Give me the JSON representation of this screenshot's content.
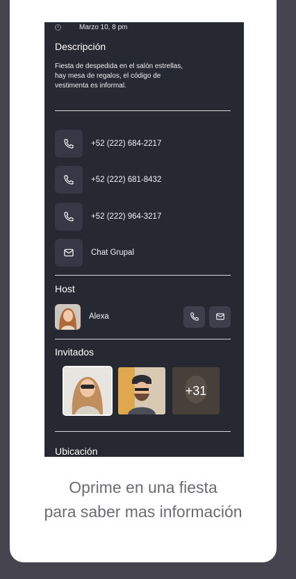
{
  "event": {
    "date": "Marzo 10, 8 pm",
    "description_title": "Descripción",
    "description": "Fiesta de despedida en el salón estrellas, hay mesa de regalos, el código de vestimenta es informal."
  },
  "contacts": [
    {
      "label": "+52 (222) 684-2217",
      "icon": "phone-icon"
    },
    {
      "label": "+52 (222) 681-8432",
      "icon": "phone-icon"
    },
    {
      "label": "+52 (222) 964-3217",
      "icon": "phone-icon"
    },
    {
      "label": "Chat Grupal",
      "icon": "mail-icon"
    }
  ],
  "host": {
    "title": "Host",
    "name": "Alexa"
  },
  "guests": {
    "title": "Invitados",
    "more": "+31"
  },
  "location": {
    "title": "Ubicación"
  },
  "caption": {
    "line1": "Oprime en una fiesta",
    "line2": "para saber mas información"
  },
  "colors": {
    "page_bg": "#45444f",
    "card_bg": "#ffffff",
    "phone_bg": "#262832",
    "icon_box": "#363845"
  }
}
